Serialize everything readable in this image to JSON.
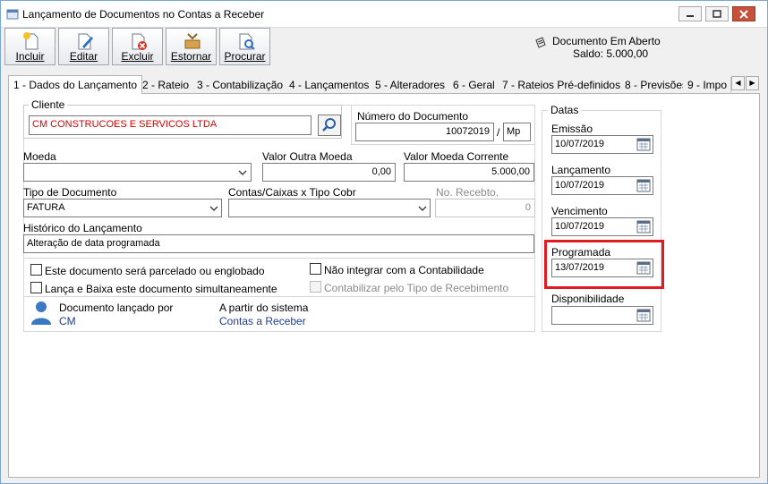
{
  "window": {
    "title": "Lançamento de Documentos no Contas a Receber"
  },
  "toolbar": {
    "buttons": [
      {
        "label": "Incluir",
        "icon": "new-document-icon"
      },
      {
        "label": "Editar",
        "icon": "edit-document-icon"
      },
      {
        "label": "Excluir",
        "icon": "delete-document-icon"
      },
      {
        "label": "Estornar",
        "icon": "reverse-icon"
      },
      {
        "label": "Procurar",
        "icon": "search-document-icon"
      }
    ]
  },
  "status": {
    "line1": "Documento Em Aberto",
    "line2": "Saldo: 5.000,00"
  },
  "tabs": [
    "1 - Dados do Lançamento",
    "2 - Rateio",
    "3 - Contabilização",
    "4 - Lançamentos",
    "5 - Alteradores",
    "6 - Geral",
    "7 - Rateios Pré-definidos",
    "8 - Previsões",
    "9 - Impo"
  ],
  "form": {
    "cliente": {
      "label": "Cliente",
      "value": "CM CONSTRUCOES E SERVICOS LTDA"
    },
    "numero_documento": {
      "label": "Número do Documento",
      "value": "10072019",
      "separator": "/",
      "suffix": "Mp"
    },
    "moeda": {
      "label": "Moeda",
      "value": ""
    },
    "valor_outra_moeda": {
      "label": "Valor Outra Moeda",
      "value": "0,00"
    },
    "valor_moeda_corrente": {
      "label": "Valor Moeda Corrente",
      "value": "5.000,00"
    },
    "tipo_documento": {
      "label": "Tipo de Documento",
      "value": "FATURA"
    },
    "contas_caixas": {
      "label": "Contas/Caixas x Tipo Cobr",
      "value": ""
    },
    "no_recebto": {
      "label": "No. Recebto.",
      "value": "0"
    },
    "historico": {
      "label": "Histórico do Lançamento",
      "value": "Alteração de data programada"
    },
    "checkboxes": {
      "parcelado": "Este documento será parcelado ou englobado",
      "lanca_baixa": "Lança e Baixa este documento simultaneamente",
      "nao_integrar": "Não integrar com a Contabilidade",
      "contabilizar": "Contabilizar pelo Tipo de Recebimento"
    },
    "lancado_por": {
      "label": "Documento lançado por",
      "value": "CM"
    },
    "sistema": {
      "label": "A partir do sistema",
      "value": "Contas a Receber"
    }
  },
  "datas": {
    "title": "Datas",
    "emissao": {
      "label": "Emissão",
      "value": "10/07/2019"
    },
    "lancamento": {
      "label": "Lançamento",
      "value": "10/07/2019"
    },
    "vencimento": {
      "label": "Vencimento",
      "value": "10/07/2019"
    },
    "programada": {
      "label": "Programada",
      "value": "13/07/2019"
    },
    "disponibilidade": {
      "label": "Disponibilidade",
      "value": ""
    }
  },
  "colors": {
    "highlight": "#e01b22",
    "client_text": "#d40000",
    "link": "#1b3d8f"
  }
}
